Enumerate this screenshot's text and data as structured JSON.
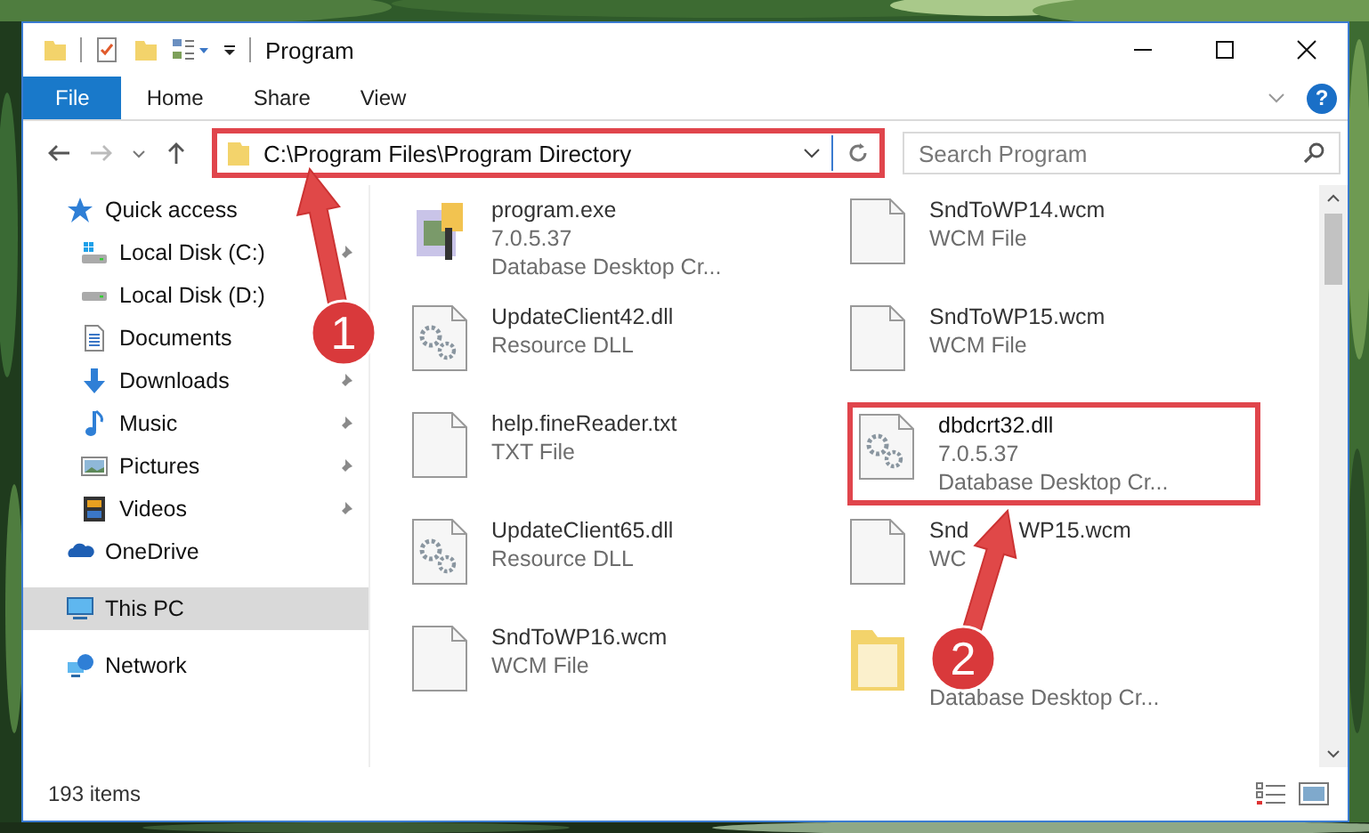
{
  "window": {
    "title": "Program"
  },
  "ribbon_tabs": [
    {
      "label": "File",
      "selected": true
    },
    {
      "label": "Home",
      "selected": false
    },
    {
      "label": "Share",
      "selected": false
    },
    {
      "label": "View",
      "selected": false
    }
  ],
  "help_button": {
    "label": "?"
  },
  "address": {
    "path": "C:\\Program Files\\Program Directory",
    "highlighted": true
  },
  "search": {
    "placeholder": "Search Program"
  },
  "sidebar": {
    "items": [
      {
        "label": "Quick access",
        "kind": "star",
        "selected": false,
        "children": [
          {
            "label": "Local Disk (C:)",
            "kind": "system-disk",
            "pinned": true
          },
          {
            "label": "Local Disk (D:)",
            "kind": "disk"
          },
          {
            "label": "Documents",
            "kind": "document"
          },
          {
            "label": "Downloads",
            "kind": "download",
            "pinned": true
          },
          {
            "label": "Music",
            "kind": "music",
            "pinned": true
          },
          {
            "label": "Pictures",
            "kind": "pictures",
            "pinned": true
          },
          {
            "label": "Videos",
            "kind": "film",
            "pinned": true
          }
        ]
      },
      {
        "label": "OneDrive",
        "kind": "cloud",
        "selected": false
      },
      {
        "label": "This PC",
        "kind": "computer",
        "selected": true
      },
      {
        "label": "Network",
        "kind": "network",
        "selected": false
      }
    ]
  },
  "files": [
    {
      "name": "program.exe",
      "lines": [
        "7.0.5.37",
        "Database Desktop Cr..."
      ],
      "kind": "exe",
      "highlighted": false
    },
    {
      "name": "SndToWP14.wcm",
      "lines": [
        "WCM File"
      ],
      "kind": "file",
      "highlighted": false
    },
    {
      "name": "UpdateClient42.dll",
      "lines": [
        "Resource DLL"
      ],
      "kind": "dll",
      "highlighted": false
    },
    {
      "name": "SndToWP15.wcm",
      "lines": [
        "WCM File"
      ],
      "kind": "file",
      "highlighted": false
    },
    {
      "name": "help.fineReader.txt",
      "lines": [
        "TXT File"
      ],
      "kind": "file",
      "highlighted": false
    },
    {
      "name": "dbdcrt32.dll",
      "lines": [
        "7.0.5.37",
        "Database Desktop Cr..."
      ],
      "kind": "dll",
      "highlighted": true
    },
    {
      "name": "UpdateClient65.dll",
      "lines": [
        "Resource DLL"
      ],
      "kind": "dll",
      "highlighted": false
    },
    {
      "name_parts": [
        "Snd",
        "WP15.wcm"
      ],
      "lines": [
        "WC"
      ],
      "kind": "file",
      "highlighted": false
    },
    {
      "name": "SndToWP16.wcm",
      "lines": [
        "WCM File"
      ],
      "kind": "file",
      "highlighted": false
    },
    {
      "lines": [
        "Database Desktop Cr..."
      ],
      "kind": "folder",
      "highlighted": false
    }
  ],
  "status_bar": {
    "item_count": "193 items"
  },
  "callouts": [
    {
      "label": "1"
    },
    {
      "label": "2"
    }
  ]
}
